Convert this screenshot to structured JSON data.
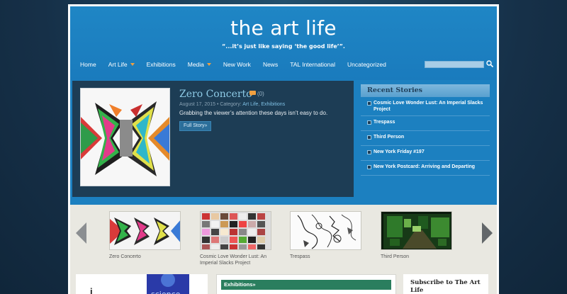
{
  "site": {
    "title": "the art life",
    "tagline": "“...it’s just like saying ‘the good life’”."
  },
  "nav": {
    "items": [
      {
        "label": "Home",
        "has_dropdown": false
      },
      {
        "label": "Art Life",
        "has_dropdown": true
      },
      {
        "label": "Exhibitions",
        "has_dropdown": false
      },
      {
        "label": "Media",
        "has_dropdown": true
      },
      {
        "label": "New Work",
        "has_dropdown": false
      },
      {
        "label": "News",
        "has_dropdown": false
      },
      {
        "label": "TAL International",
        "has_dropdown": false
      },
      {
        "label": "Uncategorized",
        "has_dropdown": false
      }
    ],
    "search": {
      "value": "",
      "placeholder": "",
      "icon": "search-icon"
    }
  },
  "feature": {
    "title": "Zero Concerto",
    "comments": "(0)",
    "date": "August 17, 2015",
    "category_prefix": "• Category:",
    "categories": [
      "Art Life",
      "Exhibitions"
    ],
    "excerpt": "Grabbing the viewer’s attention these days isn’t easy to do.",
    "button": "Full Story»"
  },
  "recent": {
    "heading": "Recent Stories",
    "items": [
      "Cosmic Love Wonder Lust: An Imperial Slacks Project",
      "Trespass",
      "Third Person",
      "New York Friday #197",
      "New York Postcard: Arriving and Departing"
    ]
  },
  "carousel": {
    "items": [
      {
        "caption": "Zero Concerto"
      },
      {
        "caption": "Cosmic Love Wonder Lust: An Imperial Slacks Project"
      },
      {
        "caption": "Trespass"
      },
      {
        "caption": "Third Person"
      }
    ]
  },
  "bottom": {
    "exhibitions": "Exhibitions»",
    "subscribe": "Subscribe to The Art Life",
    "partial_text": "i",
    "science_text": "science"
  },
  "colors": {
    "header_blue": "#1f86c5",
    "feature_dark": "#1d3d55",
    "feature_title": "#8ecbe6",
    "exhibitions_green": "#2a7e5e"
  }
}
